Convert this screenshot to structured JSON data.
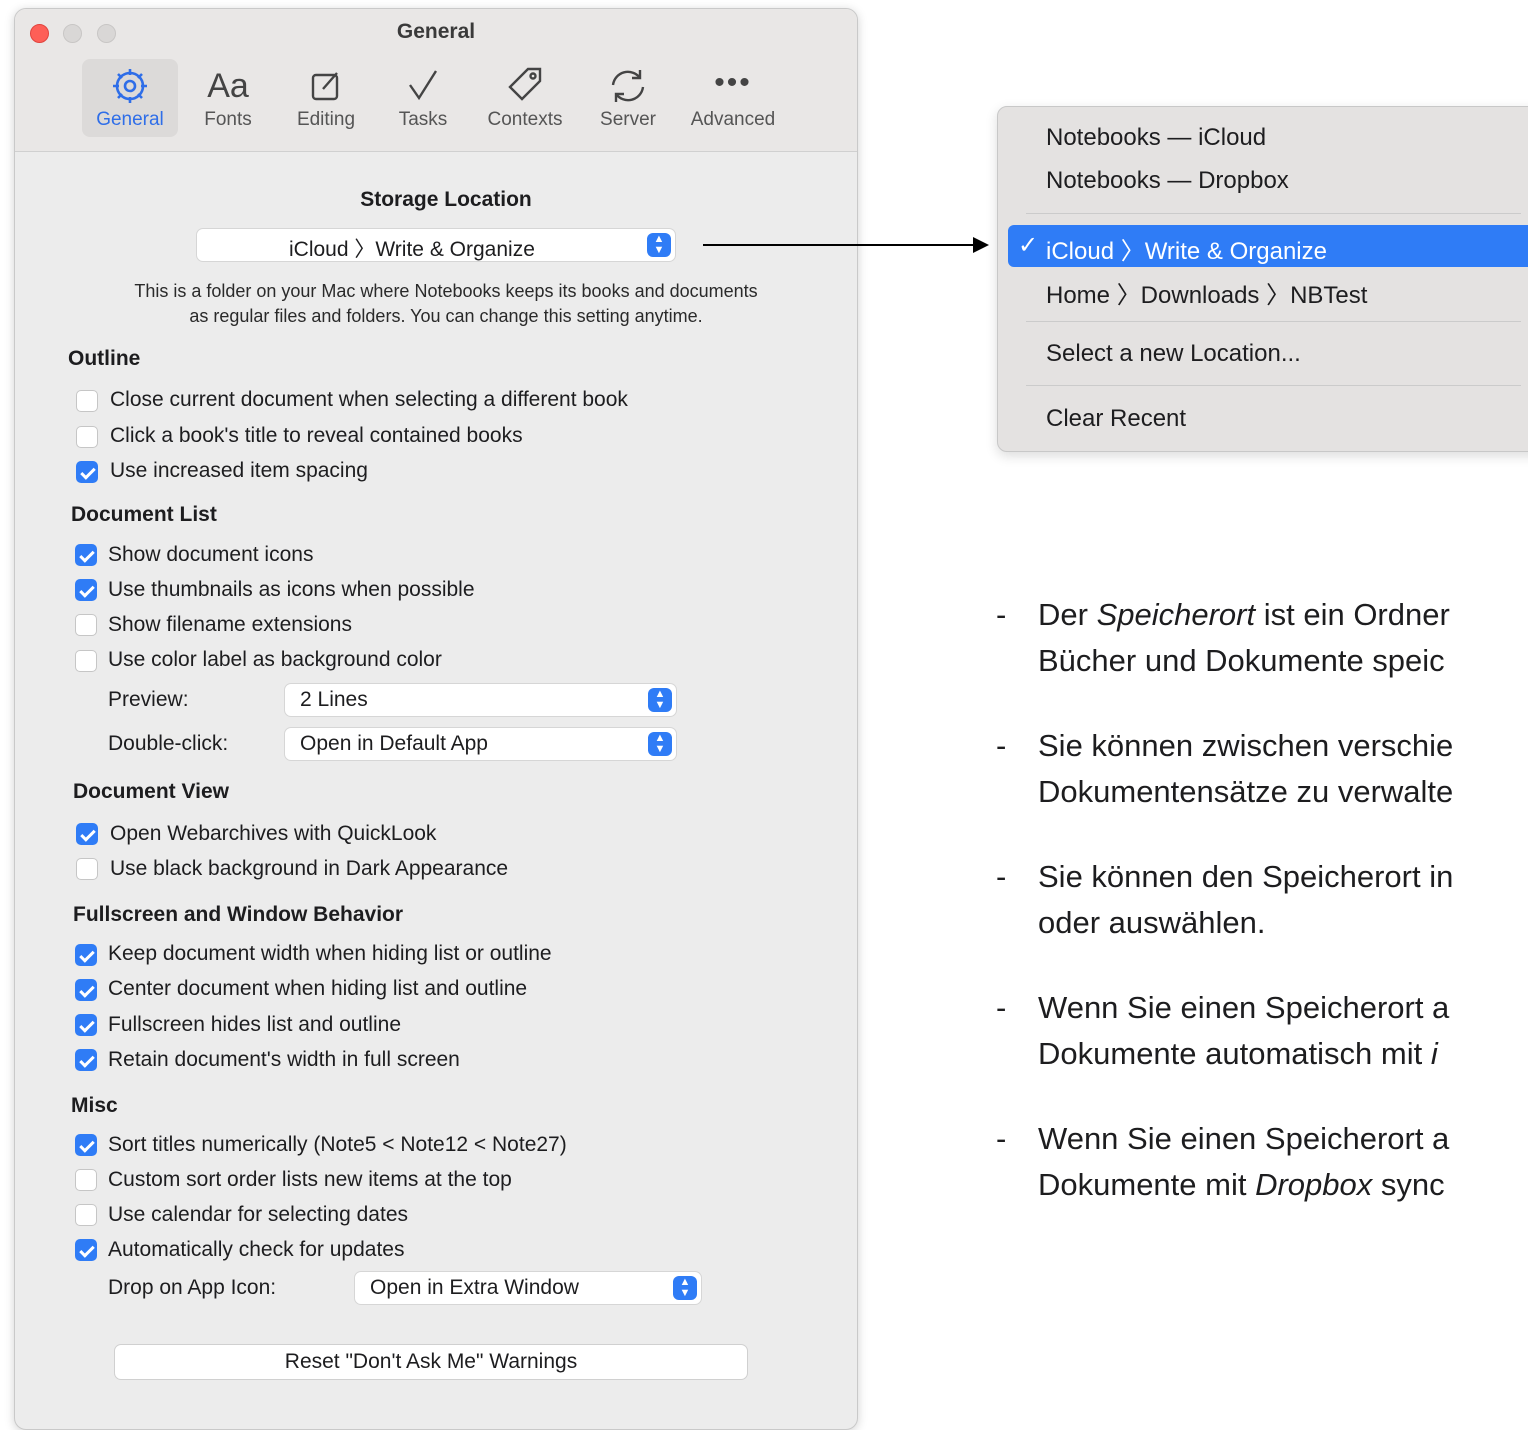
{
  "window": {
    "title": "General",
    "tabs": [
      {
        "label": "General",
        "icon": "gear-icon",
        "active": true
      },
      {
        "label": "Fonts",
        "icon": "fonts-icon"
      },
      {
        "label": "Editing",
        "icon": "editing-icon"
      },
      {
        "label": "Tasks",
        "icon": "checkmark-icon"
      },
      {
        "label": "Contexts",
        "icon": "tag-icon"
      },
      {
        "label": "Server",
        "icon": "sync-icon"
      },
      {
        "label": "Advanced",
        "icon": "ellipsis-icon"
      }
    ]
  },
  "storage": {
    "title": "Storage Location",
    "popup_value": "iCloud 〉Write & Organize",
    "description_line1": "This is a folder on your Mac where Notebooks keeps its books and documents",
    "description_line2": "as regular files and folders. You can change this setting anytime."
  },
  "outline": {
    "title": "Outline",
    "options": [
      {
        "label": "Close current document when selecting a different book",
        "checked": false
      },
      {
        "label": "Click a book's title to reveal contained books",
        "checked": false
      },
      {
        "label": "Use increased item spacing",
        "checked": true
      }
    ]
  },
  "document_list": {
    "title": "Document List",
    "options": [
      {
        "label": "Show document icons",
        "checked": true
      },
      {
        "label": "Use thumbnails as icons when possible",
        "checked": true
      },
      {
        "label": "Show filename extensions",
        "checked": false
      },
      {
        "label": "Use color label as background color",
        "checked": false
      }
    ],
    "preview_label": "Preview:",
    "preview_value": "2 Lines",
    "doubleclick_label": "Double-click:",
    "doubleclick_value": "Open in Default App"
  },
  "document_view": {
    "title": "Document View",
    "options": [
      {
        "label": "Open Webarchives with QuickLook",
        "checked": true
      },
      {
        "label": "Use black background in Dark Appearance",
        "checked": false
      }
    ]
  },
  "fullscreen": {
    "title": "Fullscreen and Window Behavior",
    "options": [
      {
        "label": "Keep document width when hiding list or outline",
        "checked": true
      },
      {
        "label": "Center document when hiding list and outline",
        "checked": true
      },
      {
        "label": "Fullscreen hides list and outline",
        "checked": true
      },
      {
        "label": "Retain document's width in full screen",
        "checked": true
      }
    ]
  },
  "misc": {
    "title": "Misc",
    "options": [
      {
        "label": "Sort titles numerically (Note5 < Note12 < Note27)",
        "checked": true
      },
      {
        "label": "Custom sort order lists new items at the top",
        "checked": false
      },
      {
        "label": "Use calendar for selecting dates",
        "checked": false
      },
      {
        "label": "Automatically check for updates",
        "checked": true
      }
    ],
    "drop_label": "Drop on App Icon:",
    "drop_value": "Open in Extra Window",
    "reset_button": "Reset \"Don't Ask Me\" Warnings"
  },
  "menu": {
    "items": [
      {
        "label": "Notebooks — iCloud"
      },
      {
        "label": "Notebooks — Dropbox"
      },
      {
        "label": "iCloud 〉Write & Organize",
        "selected": true
      },
      {
        "label": "Home 〉Downloads 〉NBTest"
      },
      {
        "label": "Select a new Location..."
      },
      {
        "label": "Clear Recent"
      }
    ],
    "check_mark": "✓"
  },
  "notes": [
    {
      "dash": "-",
      "line1_a": "Der ",
      "line1_em": "Speicherort",
      "line1_b": " ist ein Ordner",
      "line2": "Bücher und Dokumente speic"
    },
    {
      "dash": "-",
      "line1": "Sie können zwischen verschie",
      "line2": "Dokumentensätze zu verwalte"
    },
    {
      "dash": "-",
      "line1": "Sie können den Speicherort in",
      "line2": "oder auswählen."
    },
    {
      "dash": "-",
      "line1": "Wenn Sie einen Speicherort a",
      "line2_a": "Dokumente automatisch mit ",
      "line2_em": "i"
    },
    {
      "dash": "-",
      "line1": "Wenn Sie einen Speicherort a",
      "line2_a": "Dokumente mit ",
      "line2_em": "Dropbox",
      "line2_b": " sync"
    }
  ],
  "colors": {
    "accent": "#2f7cf6",
    "close": "#fe5f57"
  }
}
